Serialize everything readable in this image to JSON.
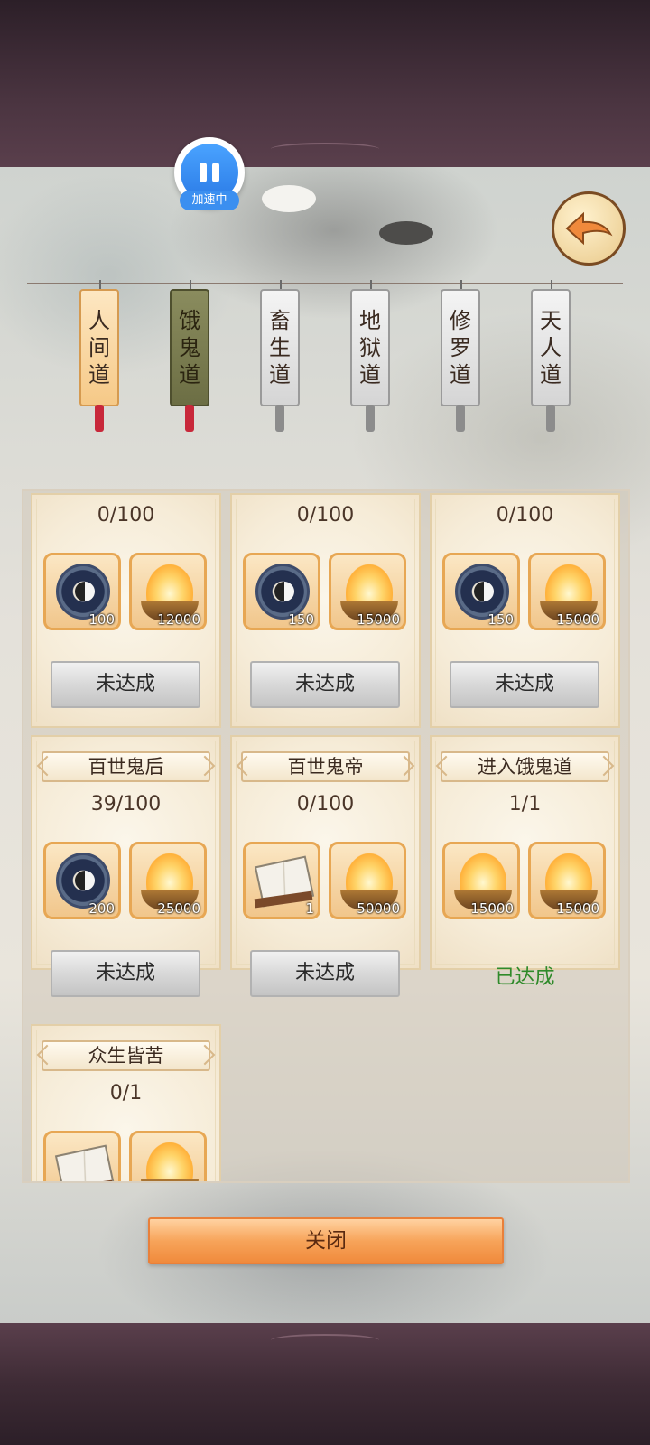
{
  "speed_indicator": {
    "label": "加速中"
  },
  "tabs": [
    {
      "label_lines": [
        "人",
        "间",
        "道"
      ],
      "style": "active"
    },
    {
      "label_lines": [
        "饿",
        "鬼",
        "道"
      ],
      "style": "ghost"
    },
    {
      "label_lines": [
        "畜",
        "生",
        "道"
      ],
      "style": "white"
    },
    {
      "label_lines": [
        "地",
        "狱",
        "道"
      ],
      "style": "white"
    },
    {
      "label_lines": [
        "修",
        "罗",
        "道"
      ],
      "style": "white"
    },
    {
      "label_lines": [
        "天",
        "人",
        "道"
      ],
      "style": "white"
    }
  ],
  "cards": [
    {
      "title": "",
      "progress": "0/100",
      "rewards": [
        {
          "icon": "bagua-amulet-icon",
          "qty": "100"
        },
        {
          "icon": "spirit-flame-bowl-icon",
          "qty": "12000"
        }
      ],
      "status": "未达成",
      "done": false
    },
    {
      "title": "",
      "progress": "0/100",
      "rewards": [
        {
          "icon": "bagua-amulet-icon",
          "qty": "150"
        },
        {
          "icon": "spirit-flame-bowl-icon",
          "qty": "15000"
        }
      ],
      "status": "未达成",
      "done": false
    },
    {
      "title": "",
      "progress": "0/100",
      "rewards": [
        {
          "icon": "bagua-amulet-icon",
          "qty": "150"
        },
        {
          "icon": "spirit-flame-bowl-icon",
          "qty": "15000"
        }
      ],
      "status": "未达成",
      "done": false
    },
    {
      "title": "百世鬼后",
      "progress": "39/100",
      "rewards": [
        {
          "icon": "bagua-amulet-icon",
          "qty": "200"
        },
        {
          "icon": "spirit-flame-bowl-icon",
          "qty": "25000"
        }
      ],
      "status": "未达成",
      "done": false
    },
    {
      "title": "百世鬼帝",
      "progress": "0/100",
      "rewards": [
        {
          "icon": "scroll-book-icon",
          "qty": "1"
        },
        {
          "icon": "spirit-flame-bowl-icon",
          "qty": "50000"
        }
      ],
      "status": "未达成",
      "done": false
    },
    {
      "title": "进入饿鬼道",
      "progress": "1/1",
      "rewards": [
        {
          "icon": "spirit-flame-bowl-icon",
          "qty": "15000"
        },
        {
          "icon": "spirit-flame-bowl-icon",
          "qty": "15000"
        }
      ],
      "status": "已达成",
      "done": true
    },
    {
      "title": "众生皆苦",
      "progress": "0/1",
      "rewards": [
        {
          "icon": "scroll-book-icon",
          "qty": ""
        },
        {
          "icon": "spirit-flame-bowl-icon",
          "qty": ""
        }
      ],
      "status": "",
      "done": false
    }
  ],
  "close_button": {
    "label": "关闭"
  },
  "colors": {
    "accent_orange": "#f08a3c",
    "done_green": "#2f8a2a",
    "frame_purple": "#4a3440"
  }
}
